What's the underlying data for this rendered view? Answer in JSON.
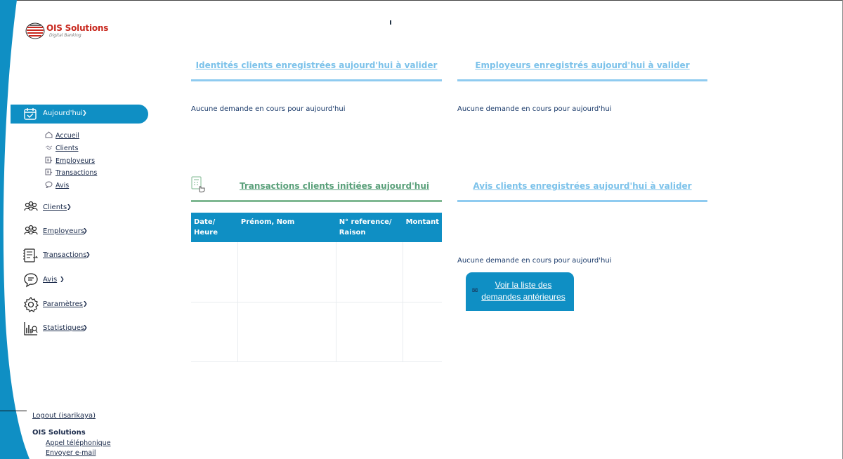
{
  "brand": {
    "name": "OIS Solutions",
    "tagline": "Digital Banking"
  },
  "sidebar": {
    "active": {
      "label": "Aujourd'hui"
    },
    "sub_items": [
      {
        "label": "Accueil",
        "icon": "home-icon"
      },
      {
        "label": "Clients",
        "icon": "handshake-icon"
      },
      {
        "label": "Employeurs",
        "icon": "document-icon"
      },
      {
        "label": "Transactions",
        "icon": "document-icon"
      },
      {
        "label": "Avis",
        "icon": "comment-icon"
      }
    ],
    "items": [
      {
        "label": "Clients",
        "icon": "users-icon"
      },
      {
        "label": "Employeurs",
        "icon": "users-icon"
      },
      {
        "label": "Transactions",
        "icon": "ledger-icon"
      },
      {
        "label": "Avis",
        "icon": "chat-icon"
      },
      {
        "label": "Paramètres",
        "icon": "gear-icon"
      },
      {
        "label": "Statistiques",
        "icon": "stats-icon"
      }
    ]
  },
  "footer": {
    "logout": "Logout (isarikaya)",
    "company": "OIS Solutions",
    "phone": "Appel téléphonique",
    "email": "Envoyer e-mail"
  },
  "sections": {
    "identities": {
      "title": "Identités clients enregistrées aujourd'hui à valider",
      "empty": "Aucune demande en cours pour aujourd'hui"
    },
    "employers": {
      "title": "Employeurs enregistrés aujourd'hui à valider",
      "empty": "Aucune demande en cours pour aujourd'hui"
    },
    "transactions": {
      "title": "Transactions clients initiées aujourd'hui",
      "columns": [
        "Date/ Heure",
        "Prénom, Nom",
        "N° reference/ Raison",
        "Montant"
      ]
    },
    "avis": {
      "title": "Avis clients enregistrées aujourd'hui à valider",
      "empty": "Aucune demande en cours pour aujourd'hui",
      "button": "Voir la liste des demandes antérieures"
    }
  },
  "colors": {
    "accent": "#0f8fc4",
    "title": "#7cc2ea",
    "green": "#5aa07a",
    "brand_red": "#c8281e"
  }
}
